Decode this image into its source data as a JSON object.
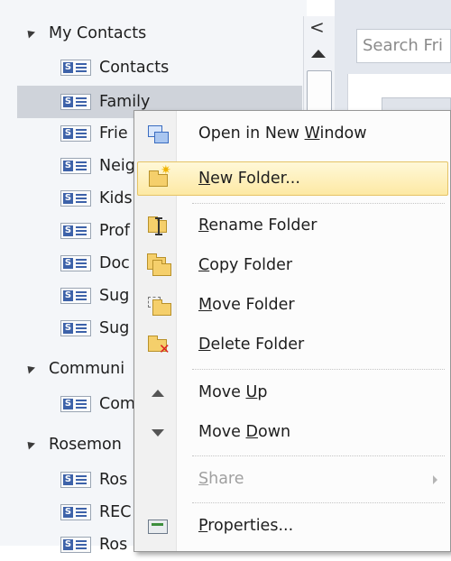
{
  "nav": {
    "groups": [
      {
        "label": "My Contacts"
      },
      {
        "label": "Communi"
      },
      {
        "label": "Rosemon"
      }
    ],
    "items": [
      {
        "label": "Contacts"
      },
      {
        "label": "Family"
      },
      {
        "label": "Frie"
      },
      {
        "label": "Neig"
      },
      {
        "label": "Kids"
      },
      {
        "label": "Prof"
      },
      {
        "label": "Doc"
      },
      {
        "label": "Sug"
      },
      {
        "label": "Sug"
      },
      {
        "label": "Com"
      },
      {
        "label": "Ros"
      },
      {
        "label": "REC"
      },
      {
        "label": "Ros"
      }
    ],
    "collapse_glyph": "<"
  },
  "search": {
    "placeholder": "Search Fri"
  },
  "context_menu": {
    "items": [
      {
        "pre": "Open in New ",
        "key": "W",
        "post": "indow",
        "icon": "new-window-icon"
      },
      {
        "pre": "",
        "key": "N",
        "post": "ew Folder...",
        "icon": "new-folder-icon"
      },
      {
        "pre": "",
        "key": "R",
        "post": "ename Folder",
        "icon": "rename-folder-icon"
      },
      {
        "pre": "",
        "key": "C",
        "post": "opy Folder",
        "icon": "copy-folder-icon"
      },
      {
        "pre": "",
        "key": "M",
        "post": "ove Folder",
        "icon": "move-folder-icon"
      },
      {
        "pre": "",
        "key": "D",
        "post": "elete Folder",
        "icon": "delete-folder-icon"
      },
      {
        "pre": "Move ",
        "key": "U",
        "post": "p",
        "icon": "move-up-icon"
      },
      {
        "pre": "Move ",
        "key": "D",
        "post": "own",
        "icon": "move-down-icon"
      },
      {
        "pre": "",
        "key": "S",
        "post": "hare",
        "icon": "",
        "disabled": true
      },
      {
        "pre": "",
        "key": "P",
        "post": "roperties...",
        "icon": "properties-icon"
      }
    ]
  },
  "colors": {
    "selection": "#cfd3da",
    "menu_hover": "#fde9a4",
    "contact_icon": "#3d62a9"
  }
}
